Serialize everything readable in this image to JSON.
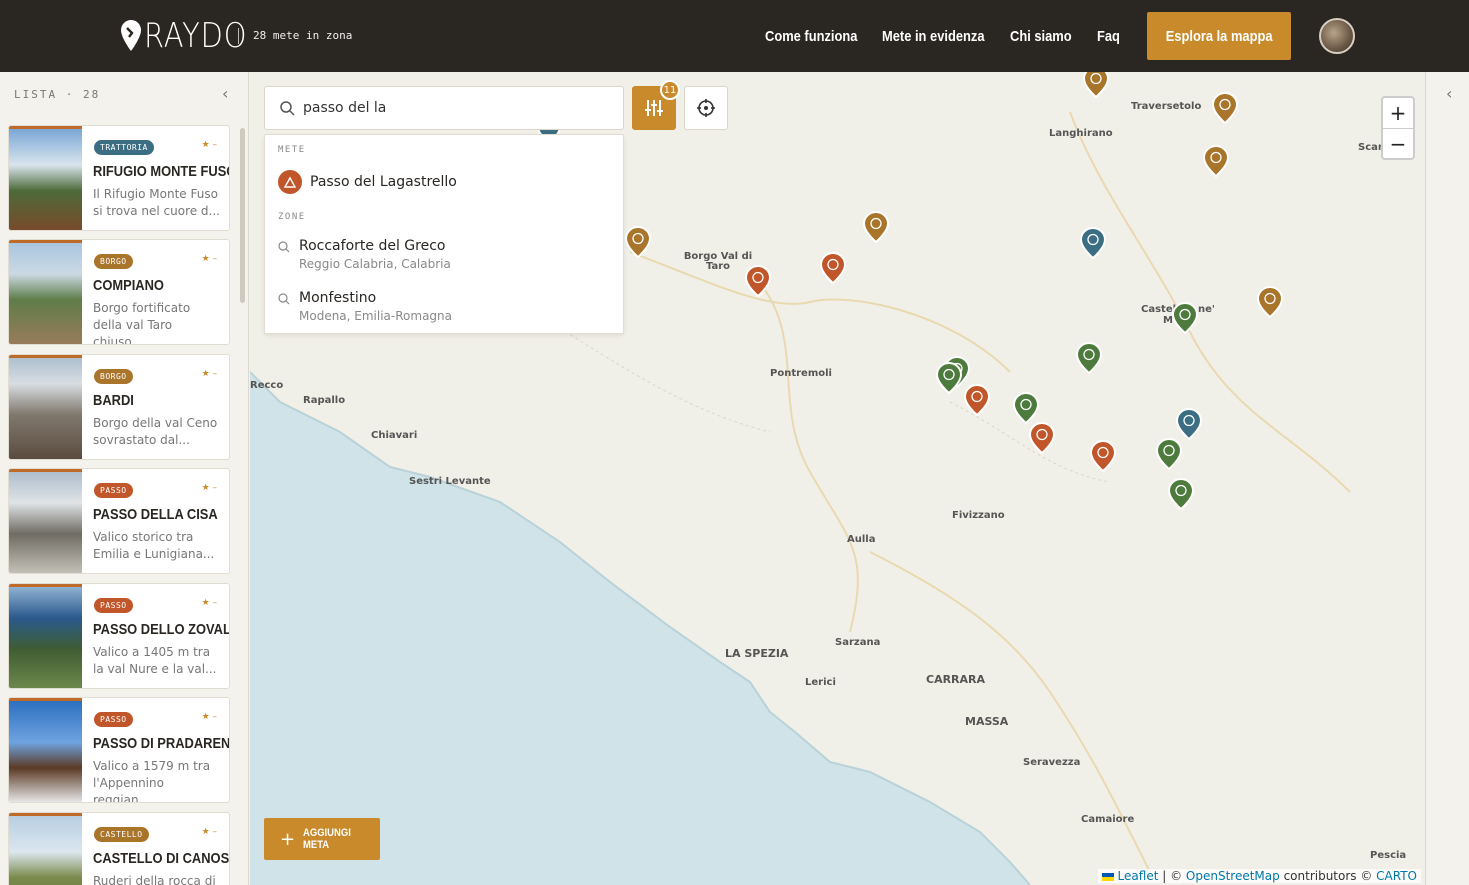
{
  "header": {
    "logo": "RAYDO",
    "count": "28 mete in zona",
    "nav": [
      "Come funziona",
      "Mete in evidenza",
      "Chi siamo",
      "Faq"
    ],
    "cta": "Esplora la mappa"
  },
  "sidebar": {
    "heading": "LISTA · 28",
    "cards": [
      {
        "badge": "TRATTORIA",
        "color": "#3c6e83",
        "title": "RIFUGIO MONTE FUSO",
        "desc": "Il Rifugio Monte Fuso si trova nel cuore d...",
        "stars": "★ –"
      },
      {
        "badge": "BORGO",
        "color": "#a8752b",
        "title": "COMPIANO",
        "desc": "Borgo fortificato della val Taro chiuso...",
        "stars": "★ –"
      },
      {
        "badge": "BORGO",
        "color": "#a8752b",
        "title": "BARDI",
        "desc": "Borgo della val Ceno sovrastato dal...",
        "stars": "★ –"
      },
      {
        "badge": "PASSO",
        "color": "#c0562a",
        "title": "PASSO DELLA CISA",
        "desc": "Valico storico tra Emilia e Lunigiana...",
        "stars": "★ –"
      },
      {
        "badge": "PASSO",
        "color": "#c0562a",
        "title": "PASSO DELLO ZOVAL...",
        "desc": "Valico a 1405 m tra la val Nure e la val...",
        "stars": "★ –"
      },
      {
        "badge": "PASSO",
        "color": "#c0562a",
        "title": "PASSO DI PRADARENA",
        "desc": "Valico a 1579 m tra l'Appennino reggian...",
        "stars": "★ –"
      },
      {
        "badge": "CASTELLO",
        "color": "#a8752b",
        "title": "CASTELLO DI CANOSSA",
        "desc": "Ruderi della rocca di",
        "stars": "★ –"
      }
    ]
  },
  "search": {
    "value": "passo del la",
    "filter_count": "11",
    "sections": {
      "mete": "METE",
      "zone": "ZONE"
    },
    "mete": [
      {
        "name": "Passo del Lagastrello"
      }
    ],
    "zone": [
      {
        "name": "Roccaforte del Greco",
        "sub": "Reggio Calabria, Calabria"
      },
      {
        "name": "Monfestino",
        "sub": "Modena, Emilia-Romagna"
      }
    ]
  },
  "map": {
    "add_label": "AGGIUNGI META",
    "zoom_in": "+",
    "zoom_out": "−",
    "attribution": {
      "leaflet": "Leaflet",
      "sep": " | © ",
      "osm": "OpenStreetMap",
      "mid": " contributors © ",
      "carto": "CARTO"
    },
    "cities": [
      "Traversetolo",
      "Langhirano",
      "Scan",
      "Borgo Val di Taro",
      "Castel",
      "M",
      "ne'",
      "Pontremoli",
      "Recco",
      "Rapallo",
      "Chiavari",
      "Sestri Levante",
      "Fivizzano",
      "Aulla",
      "LA SPEZIA",
      "Sarzana",
      "Lerici",
      "CARRARA",
      "MASSA",
      "Seravezza",
      "Camaiore",
      "Pescia"
    ]
  }
}
